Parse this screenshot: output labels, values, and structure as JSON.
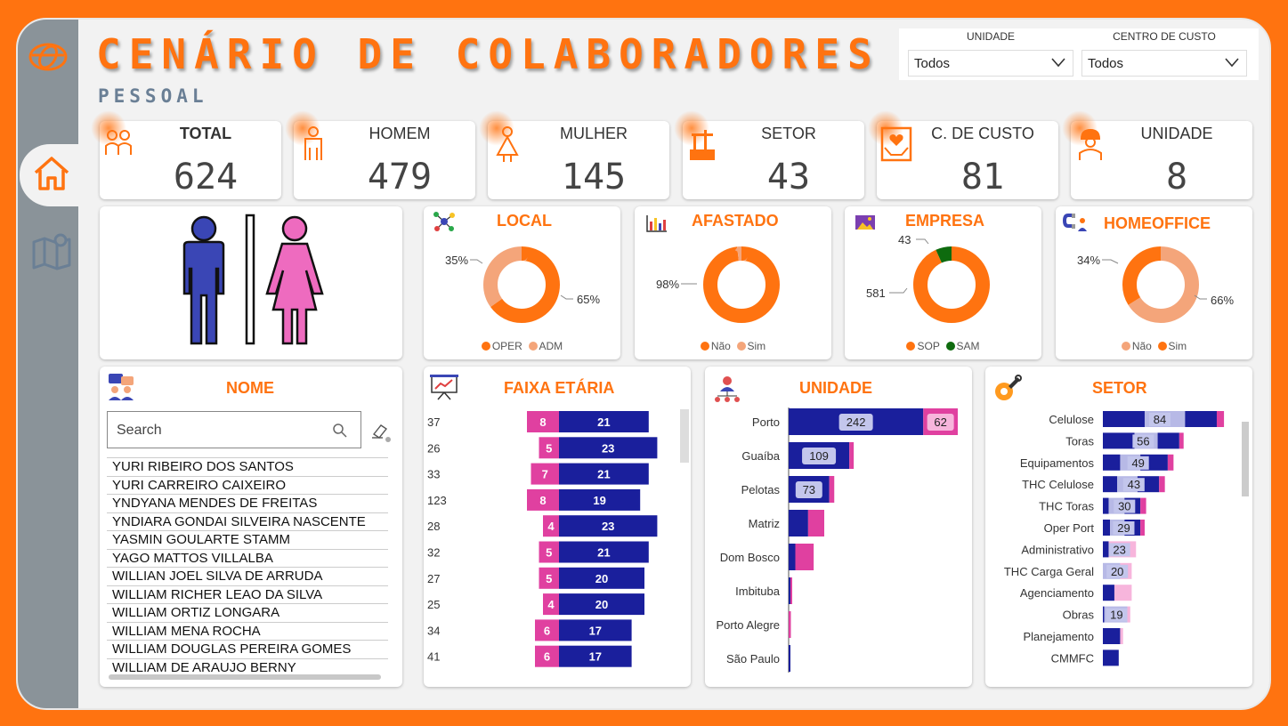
{
  "header": {
    "title": "CENÁRIO DE COLABORADORES",
    "subtitle": "PESSOAL"
  },
  "filters": [
    {
      "label": "UNIDADE",
      "value": "Todos"
    },
    {
      "label": "CENTRO DE CUSTO",
      "value": "Todos"
    }
  ],
  "kpis": [
    {
      "label": "TOTAL",
      "value": "624",
      "icon": "people-icon"
    },
    {
      "label": "HOMEM",
      "value": "479",
      "icon": "man-icon"
    },
    {
      "label": "MULHER",
      "value": "145",
      "icon": "woman-icon"
    },
    {
      "label": "SETOR",
      "value": "43",
      "icon": "factory-icon"
    },
    {
      "label": "C. DE CUSTO",
      "value": "81",
      "icon": "heart-hands-icon"
    },
    {
      "label": "UNIDADE",
      "value": "8",
      "icon": "worker-icon"
    }
  ],
  "donuts": [
    {
      "title": "LOCAL",
      "slices": [
        {
          "name": "OPER",
          "value": 65,
          "label": "65%",
          "color": "#ff7310"
        },
        {
          "name": "ADM",
          "value": 35,
          "label": "35%",
          "color": "#f4a57a"
        }
      ],
      "legend": [
        "OPER",
        "ADM"
      ]
    },
    {
      "title": "AFASTADO",
      "slices": [
        {
          "name": "Não",
          "value": 98,
          "label": "98%",
          "color": "#ff7310"
        },
        {
          "name": "Sim",
          "value": 2,
          "label": "",
          "color": "#f4a57a"
        }
      ],
      "legend": [
        "Não",
        "Sim"
      ]
    },
    {
      "title": "EMPRESA",
      "slices": [
        {
          "name": "SOP",
          "value": 581,
          "label": "581",
          "color": "#ff7310"
        },
        {
          "name": "SAM",
          "value": 43,
          "label": "43",
          "color": "#0e6b0e"
        }
      ],
      "legend": [
        "SOP",
        "SAM"
      ]
    },
    {
      "title": "HOMEOFFICE",
      "slices": [
        {
          "name": "Sim",
          "value": 66,
          "label": "66%",
          "color": "#f4a57a"
        },
        {
          "name": "Não",
          "value": 34,
          "label": "34%",
          "color": "#ff7310"
        }
      ],
      "legend": [
        "Não",
        "Sim"
      ]
    }
  ],
  "nome": {
    "title": "NOME",
    "search_placeholder": "Search",
    "names": [
      "YURI RIBEIRO DOS SANTOS",
      "YURI CARREIRO CAIXEIRO",
      "YNDYANA MENDES DE FREITAS",
      "YNDIARA GONDAI SILVEIRA NASCENTE",
      "YASMIN GOULARTE STAMM",
      "YAGO MATTOS VILLALBA",
      "WILLIAN JOEL SILVA DE ARRUDA",
      "WILLIAM RICHER LEAO DA SILVA",
      "WILLIAM ORTIZ LONGARA",
      "WILLIAM MENA ROCHA",
      "WILLIAM DOUGLAS PEREIRA GOMES",
      "WILLIAM DE ARAUJO BERNY"
    ]
  },
  "chart_data": [
    {
      "type": "bar",
      "title": "FAIXA ETÁRIA",
      "categories": [
        "37",
        "26",
        "33",
        "123",
        "28",
        "32",
        "27",
        "25",
        "34",
        "41"
      ],
      "series": [
        {
          "values": [
            8,
            5,
            7,
            8,
            4,
            5,
            5,
            4,
            6,
            6
          ],
          "color": "#e040a0"
        },
        {
          "values": [
            21,
            23,
            21,
            19,
            23,
            21,
            20,
            20,
            17,
            17
          ],
          "color": "#1a1f9c"
        }
      ]
    },
    {
      "type": "bar",
      "title": "UNIDADE",
      "categories": [
        "Porto",
        "Guaíba",
        "Pelotas",
        "Matriz",
        "Dom Bosco",
        "Imbituba",
        "Porto Alegre",
        "São Paulo"
      ],
      "series": [
        {
          "values": [
            242,
            109,
            73,
            35,
            12,
            3,
            0,
            1
          ],
          "labels": [
            "242",
            "109",
            "73",
            "",
            "",
            "",
            "",
            ""
          ],
          "color": "#1a1f9c"
        },
        {
          "values": [
            62,
            8,
            9,
            29,
            33,
            2,
            4,
            0
          ],
          "labels": [
            "62",
            "",
            "",
            "",
            "",
            "",
            "",
            ""
          ],
          "color": "#e040a0"
        }
      ]
    },
    {
      "type": "bar",
      "title": "SETOR",
      "categories": [
        "Celulose",
        "Toras",
        "Equipamentos",
        "THC Celulose",
        "THC Toras",
        "Oper Port",
        "Administrativo",
        "THC Carga Geral",
        "Agenciamento",
        "Obras",
        "Planejamento",
        "CMMFC"
      ],
      "values": [
        84,
        56,
        49,
        43,
        30,
        29,
        23,
        20,
        20,
        19,
        14,
        11
      ],
      "series": [
        {
          "values": [
            29,
            22,
            12,
            10,
            4,
            5,
            4,
            0,
            8,
            1,
            12,
            11
          ],
          "color": "#1a1f9c"
        },
        {
          "values": [
            28,
            16,
            14,
            14,
            11,
            10,
            0,
            12,
            0,
            16,
            0,
            0
          ],
          "color": "#b7b9e6"
        },
        {
          "values": [
            22,
            15,
            19,
            15,
            11,
            11,
            0,
            0,
            0,
            0,
            0,
            0
          ],
          "color": "#1a1f9c"
        },
        {
          "values": [
            5,
            3,
            4,
            4,
            4,
            3,
            0,
            0,
            0,
            0,
            0,
            0
          ],
          "color": "#e040a0"
        },
        {
          "values": [
            0,
            0,
            0,
            0,
            0,
            0,
            19,
            8,
            12,
            2,
            2,
            0
          ],
          "color": "#f7b5dc"
        }
      ],
      "labels": [
        "84",
        "56",
        "49",
        "43",
        "30",
        "29",
        "23",
        "20",
        "",
        "19",
        "",
        ""
      ]
    }
  ]
}
